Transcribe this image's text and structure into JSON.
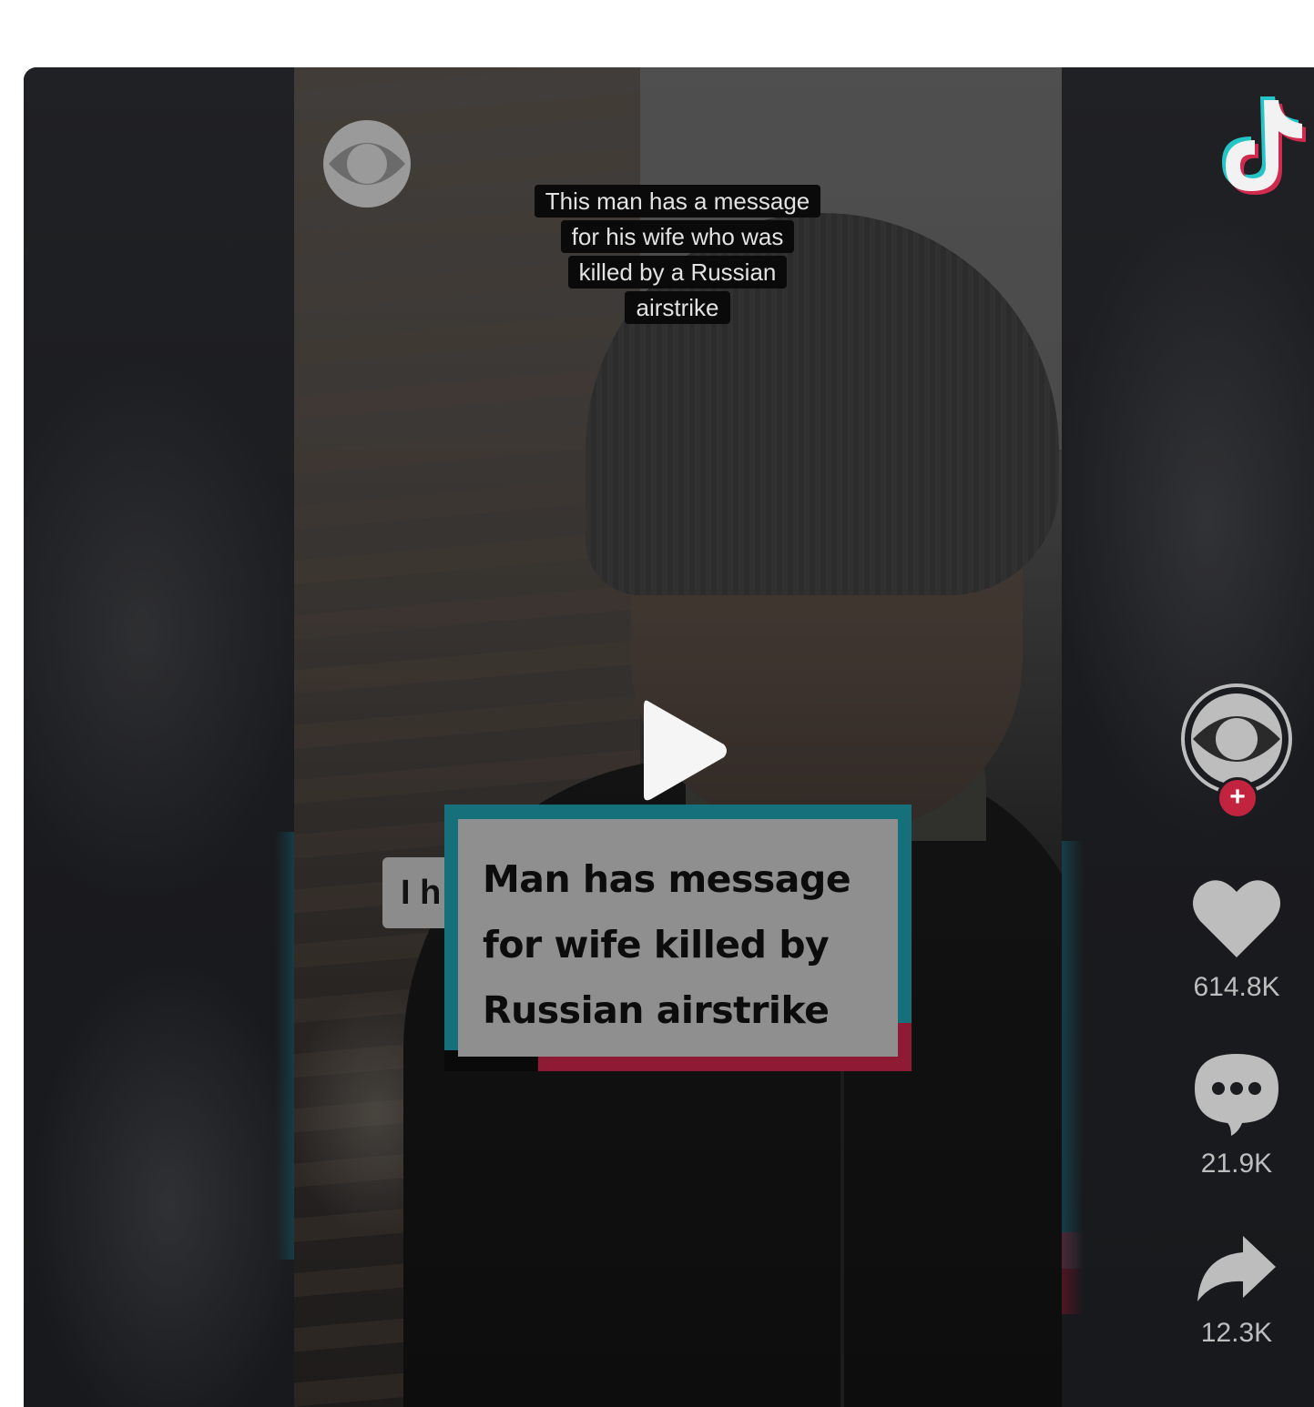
{
  "video": {
    "watermark_icon": "cbs-eye-icon",
    "caption_lines": [
      "This man has a message",
      "for his wife who was",
      "killed by a Russian",
      "airstrike"
    ],
    "subtitle_peek": "I h",
    "title_card_lines": [
      "Man has message",
      "for wife killed by",
      "Russian airstrike"
    ],
    "play_icon": "play-icon"
  },
  "rail": {
    "logo_icon": "tiktok-logo-icon",
    "avatar_icon": "cbs-eye-icon",
    "follow_label": "+",
    "likes": "614.8K",
    "comments": "21.9K",
    "shares": "12.3K"
  },
  "colors": {
    "page_bg": "#ffffff",
    "embed_bg": "#1b1c20",
    "title_card_teal": "#15707c",
    "title_card_red": "#8e1a33",
    "follow_red": "#c2233f",
    "count_text": "#bdbdbd"
  }
}
